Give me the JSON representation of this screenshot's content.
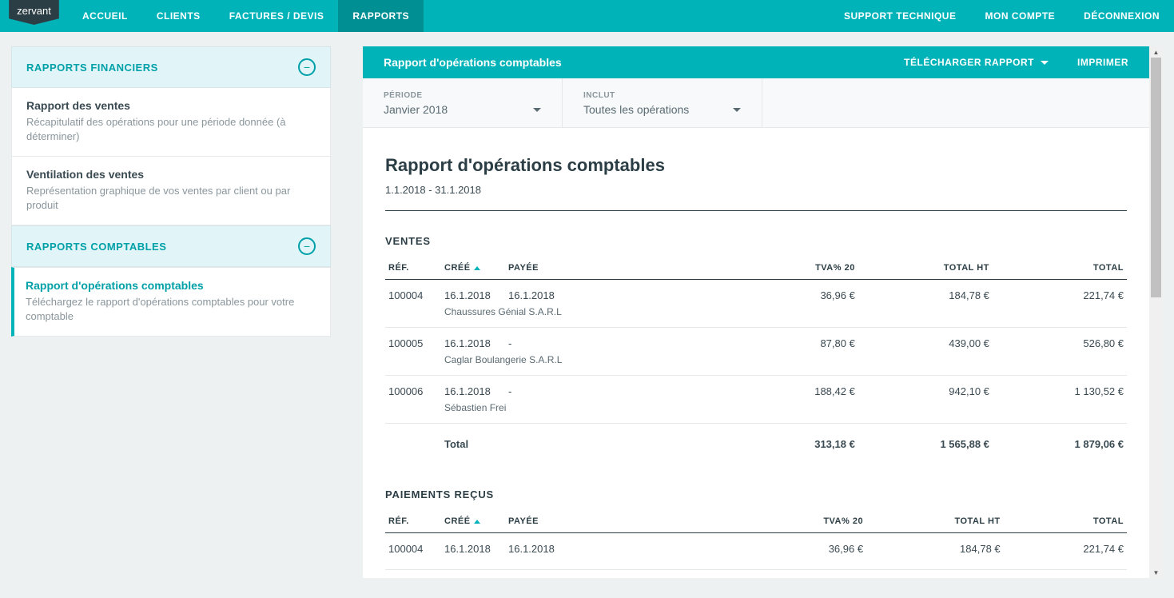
{
  "brand": "zervant",
  "nav": {
    "left": [
      "ACCUEIL",
      "CLIENTS",
      "FACTURES / DEVIS",
      "RAPPORTS"
    ],
    "activeIndex": 3,
    "right": [
      "SUPPORT TECHNIQUE",
      "MON COMPTE",
      "DÉCONNEXION"
    ]
  },
  "sidebar": {
    "groups": [
      {
        "title": "RAPPORTS FINANCIERS",
        "toggle": "−",
        "items": [
          {
            "title": "Rapport des ventes",
            "desc": "Récapitulatif des opérations pour une période donnée (à déterminer)",
            "active": false
          },
          {
            "title": "Ventilation des ventes",
            "desc": "Représentation graphique de vos ventes par client ou par produit",
            "active": false
          }
        ]
      },
      {
        "title": "RAPPORTS COMPTABLES",
        "toggle": "−",
        "items": [
          {
            "title": "Rapport d'opérations comptables",
            "desc": "Téléchargez le rapport d'opérations comptables pour votre comptable",
            "active": true
          }
        ]
      }
    ]
  },
  "main": {
    "header": {
      "title": "Rapport d'opérations comptables",
      "download": "TÉLÉCHARGER RAPPORT",
      "print": "IMPRIMER"
    },
    "filters": {
      "period": {
        "label": "PÉRIODE",
        "value": "Janvier 2018"
      },
      "include": {
        "label": "INCLUT",
        "value": "Toutes les opérations"
      }
    },
    "report": {
      "title": "Rapport d'opérations comptables",
      "range": "1.1.2018 - 31.1.2018",
      "columns": {
        "ref": "RÉF.",
        "created": "CRÉÉ",
        "paid": "PAYÉE",
        "vat": "TVA% 20",
        "totalHT": "TOTAL HT",
        "total": "TOTAL"
      },
      "sections": [
        {
          "name": "VENTES",
          "rows": [
            {
              "ref": "100004",
              "created": "16.1.2018",
              "paid": "16.1.2018",
              "detail": "Chaussures Génial S.A.R.L",
              "vat": "36,96 €",
              "totalHT": "184,78 €",
              "total": "221,74 €"
            },
            {
              "ref": "100005",
              "created": "16.1.2018",
              "paid": "-",
              "detail": "Caglar Boulangerie S.A.R.L",
              "vat": "87,80 €",
              "totalHT": "439,00 €",
              "total": "526,80 €"
            },
            {
              "ref": "100006",
              "created": "16.1.2018",
              "paid": "-",
              "detail": "Sébastien Frei",
              "vat": "188,42 €",
              "totalHT": "942,10 €",
              "total": "1 130,52 €"
            }
          ],
          "totals": {
            "label": "Total",
            "vat": "313,18 €",
            "totalHT": "1 565,88 €",
            "total": "1 879,06 €"
          }
        },
        {
          "name": "PAIEMENTS REÇUS",
          "rows": [
            {
              "ref": "100004",
              "created": "16.1.2018",
              "paid": "16.1.2018",
              "detail": "",
              "vat": "36,96 €",
              "totalHT": "184,78 €",
              "total": "221,74 €"
            }
          ]
        }
      ]
    }
  }
}
